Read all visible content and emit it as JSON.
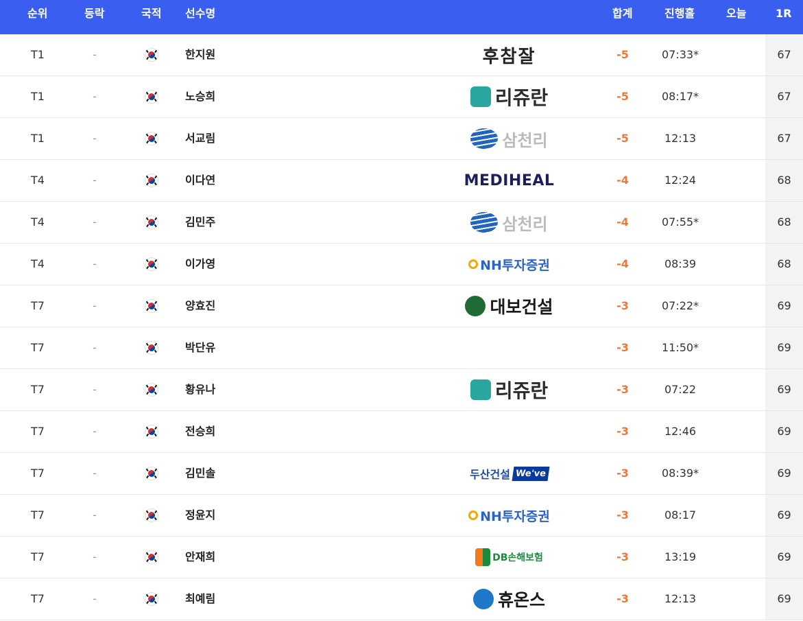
{
  "header": {
    "rank": "순위",
    "change": "등락",
    "nationality": "국적",
    "player": "선수명",
    "total": "합계",
    "thru": "진행홀",
    "today": "오늘",
    "round1": "1R"
  },
  "colors": {
    "header_bg": "#3a5ef0",
    "score_accent": "#e8793a"
  },
  "rows": [
    {
      "rank": "T1",
      "change": "-",
      "flag_icon": "korea-flag-icon",
      "name": "한지원",
      "sponsor": {
        "type": "hu",
        "text": "후참잘"
      },
      "total": "-5",
      "thru": "07:33*",
      "today": "",
      "r1": "67"
    },
    {
      "rank": "T1",
      "change": "-",
      "flag_icon": "korea-flag-icon",
      "name": "노승희",
      "sponsor": {
        "type": "rejuran",
        "text": "리쥬란"
      },
      "total": "-5",
      "thru": "08:17*",
      "today": "",
      "r1": "67"
    },
    {
      "rank": "T1",
      "change": "-",
      "flag_icon": "korea-flag-icon",
      "name": "서교림",
      "sponsor": {
        "type": "samchully",
        "text": "삼천리"
      },
      "total": "-5",
      "thru": "12:13",
      "today": "",
      "r1": "67"
    },
    {
      "rank": "T4",
      "change": "-",
      "flag_icon": "korea-flag-icon",
      "name": "이다연",
      "sponsor": {
        "type": "mediheal",
        "text": "MEDIHEAL"
      },
      "total": "-4",
      "thru": "12:24",
      "today": "",
      "r1": "68"
    },
    {
      "rank": "T4",
      "change": "-",
      "flag_icon": "korea-flag-icon",
      "name": "김민주",
      "sponsor": {
        "type": "samchully",
        "text": "삼천리"
      },
      "total": "-4",
      "thru": "07:55*",
      "today": "",
      "r1": "68"
    },
    {
      "rank": "T4",
      "change": "-",
      "flag_icon": "korea-flag-icon",
      "name": "이가영",
      "sponsor": {
        "type": "nh",
        "text": "NH투자증권"
      },
      "total": "-4",
      "thru": "08:39",
      "today": "",
      "r1": "68"
    },
    {
      "rank": "T7",
      "change": "-",
      "flag_icon": "korea-flag-icon",
      "name": "양효진",
      "sponsor": {
        "type": "daebo",
        "text": "대보건설"
      },
      "total": "-3",
      "thru": "07:22*",
      "today": "",
      "r1": "69"
    },
    {
      "rank": "T7",
      "change": "-",
      "flag_icon": "korea-flag-icon",
      "name": "박단유",
      "sponsor": null,
      "total": "-3",
      "thru": "11:50*",
      "today": "",
      "r1": "69"
    },
    {
      "rank": "T7",
      "change": "-",
      "flag_icon": "korea-flag-icon",
      "name": "황유나",
      "sponsor": {
        "type": "rejuran",
        "text": "리쥬란"
      },
      "total": "-3",
      "thru": "07:22",
      "today": "",
      "r1": "69"
    },
    {
      "rank": "T7",
      "change": "-",
      "flag_icon": "korea-flag-icon",
      "name": "전승희",
      "sponsor": null,
      "total": "-3",
      "thru": "12:46",
      "today": "",
      "r1": "69"
    },
    {
      "rank": "T7",
      "change": "-",
      "flag_icon": "korea-flag-icon",
      "name": "김민솔",
      "sponsor": {
        "type": "doosan",
        "text": "두산건설",
        "badge": "We've"
      },
      "total": "-3",
      "thru": "08:39*",
      "today": "",
      "r1": "69"
    },
    {
      "rank": "T7",
      "change": "-",
      "flag_icon": "korea-flag-icon",
      "name": "정윤지",
      "sponsor": {
        "type": "nh",
        "text": "NH투자증권"
      },
      "total": "-3",
      "thru": "08:17",
      "today": "",
      "r1": "69"
    },
    {
      "rank": "T7",
      "change": "-",
      "flag_icon": "korea-flag-icon",
      "name": "안재희",
      "sponsor": {
        "type": "db",
        "text": "DB손해보험"
      },
      "total": "-3",
      "thru": "13:19",
      "today": "",
      "r1": "69"
    },
    {
      "rank": "T7",
      "change": "-",
      "flag_icon": "korea-flag-icon",
      "name": "최예림",
      "sponsor": {
        "type": "huons",
        "text": "휴온스"
      },
      "total": "-3",
      "thru": "12:13",
      "today": "",
      "r1": "69"
    }
  ]
}
